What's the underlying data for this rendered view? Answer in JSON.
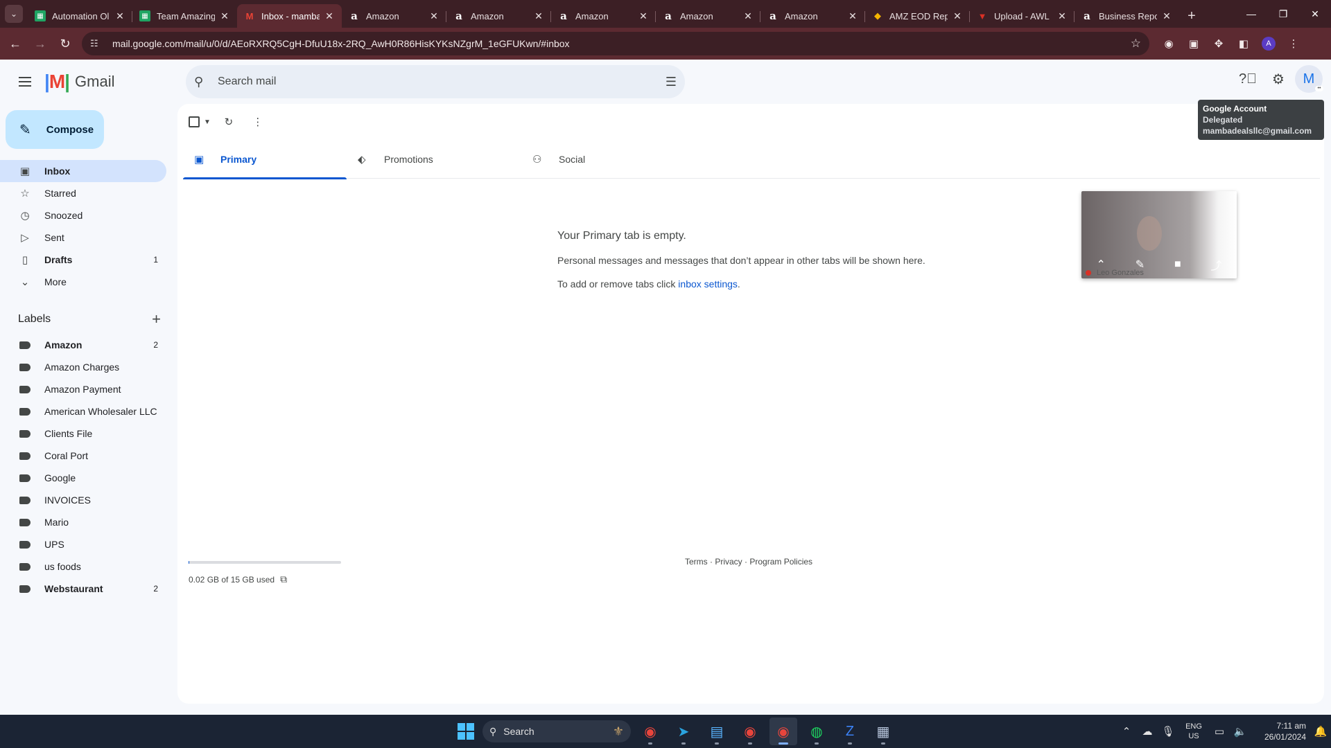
{
  "browser": {
    "tabs": [
      {
        "title": "Automation Ol",
        "icon": "sheets-icon"
      },
      {
        "title": "Team Amazing",
        "icon": "sheets-icon"
      },
      {
        "title": "Inbox - mamba",
        "icon": "gmail-icon",
        "active": true
      },
      {
        "title": "Amazon",
        "icon": "amazon-icon"
      },
      {
        "title": "Amazon",
        "icon": "amazon-icon"
      },
      {
        "title": "Amazon",
        "icon": "amazon-icon"
      },
      {
        "title": "Amazon",
        "icon": "amazon-icon"
      },
      {
        "title": "Amazon",
        "icon": "amazon-icon"
      },
      {
        "title": "AMZ EOD Repo",
        "icon": "report-icon"
      },
      {
        "title": "Upload - AWL I",
        "icon": "upload-icon"
      },
      {
        "title": "Business Repo",
        "icon": "amazon-icon"
      }
    ],
    "url": "mail.google.com/mail/u/0/d/AEoRXRQ5CgH-DfuU18x-2RQ_AwH0R86HisKYKsNZgrM_1eGFUKwn/#inbox",
    "profile_initial": "A"
  },
  "gmail": {
    "brand": "Gmail",
    "search_placeholder": "Search mail",
    "avatar_initial": "M",
    "tooltip": {
      "title": "Google Account",
      "line2": "Delegated",
      "email": "mambadealsllc@gmail.com"
    },
    "compose_label": "Compose",
    "nav": [
      {
        "label": "Inbox",
        "icon": "inbox-icon",
        "active": true,
        "count": ""
      },
      {
        "label": "Starred",
        "icon": "star-icon",
        "count": ""
      },
      {
        "label": "Snoozed",
        "icon": "clock-icon",
        "count": ""
      },
      {
        "label": "Sent",
        "icon": "send-icon",
        "count": ""
      },
      {
        "label": "Drafts",
        "icon": "draft-icon",
        "count": "1",
        "bold": true
      },
      {
        "label": "More",
        "icon": "chevron-down-icon",
        "count": ""
      }
    ],
    "labels_heading": "Labels",
    "labels": [
      {
        "label": "Amazon",
        "count": "2",
        "bold": true
      },
      {
        "label": "Amazon Charges",
        "count": ""
      },
      {
        "label": "Amazon Payment",
        "count": ""
      },
      {
        "label": "American Wholesaler LLC",
        "count": ""
      },
      {
        "label": "Clients File",
        "count": ""
      },
      {
        "label": "Coral Port",
        "count": ""
      },
      {
        "label": "Google",
        "count": ""
      },
      {
        "label": "INVOICES",
        "count": ""
      },
      {
        "label": "Mario",
        "count": ""
      },
      {
        "label": "UPS",
        "count": ""
      },
      {
        "label": "us foods",
        "count": ""
      },
      {
        "label": "Webstaurant",
        "count": "2",
        "bold": true
      }
    ],
    "tabs": [
      {
        "label": "Primary",
        "icon": "inbox-icon",
        "active": true
      },
      {
        "label": "Promotions",
        "icon": "tag-icon"
      },
      {
        "label": "Social",
        "icon": "people-icon"
      }
    ],
    "empty": {
      "heading": "Your Primary tab is empty.",
      "body": "Personal messages and messages that don’t appear in other tabs will be shown here.",
      "settings_prefix": "To add or remove tabs click ",
      "settings_link": "inbox settings",
      "settings_suffix": "."
    },
    "storage": {
      "text": "0.02 GB of 15 GB used",
      "used_fraction": 0.0013
    },
    "footer": {
      "terms": "Terms",
      "privacy": "Privacy",
      "policies": "Program Policies",
      "sep": " · "
    },
    "video": {
      "name": "Leo Gonzales"
    }
  },
  "taskbar": {
    "search_label": "Search",
    "lang_top": "ENG",
    "lang_bottom": "US",
    "time": "7:11 am",
    "date": "26/01/2024"
  },
  "colors": {
    "chrome_dark": "#3c1f25",
    "chrome_mid": "#5c2a31",
    "accent": "#0b57d0",
    "compose": "#c2e7ff",
    "active_nav": "#d3e3fd",
    "taskbar": "#1b2434"
  }
}
